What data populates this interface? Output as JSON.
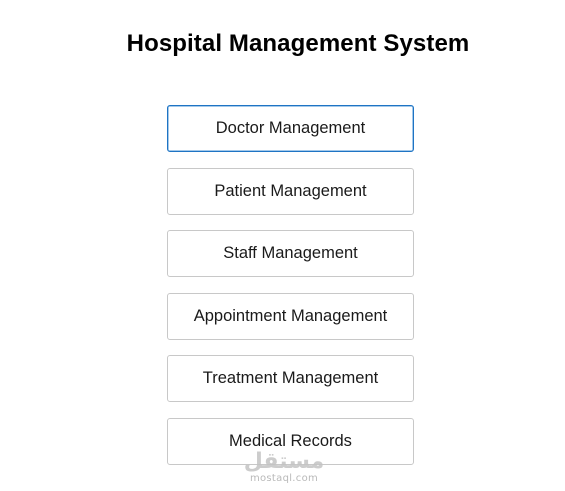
{
  "app": {
    "title": "Hospital Management System"
  },
  "menu": {
    "items": [
      {
        "label": "Doctor Management",
        "focused": true
      },
      {
        "label": "Patient Management",
        "focused": false
      },
      {
        "label": "Staff Management",
        "focused": false
      },
      {
        "label": "Appointment Management",
        "focused": false
      },
      {
        "label": "Treatment Management",
        "focused": false
      },
      {
        "label": "Medical Records",
        "focused": false
      }
    ]
  },
  "watermark": {
    "logo_text": "مستقل",
    "domain": "mostaql.com"
  },
  "colors": {
    "focus_border": "#1e74c4",
    "button_border": "#c8c8c8",
    "title_text": "#000000",
    "watermark": "#c4c4c4"
  }
}
